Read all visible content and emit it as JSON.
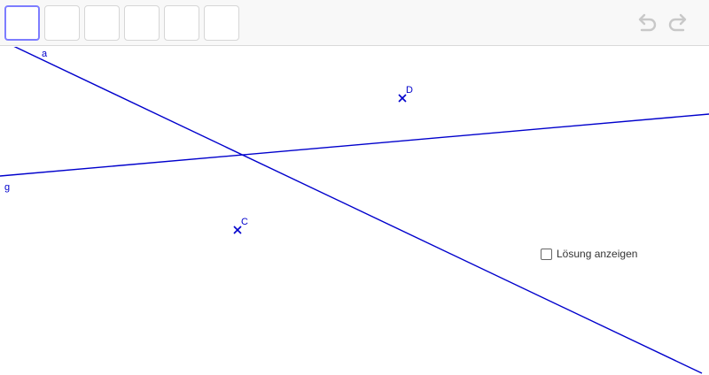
{
  "toolbar": {
    "tools": [
      "",
      "",
      "",
      "",
      "",
      ""
    ],
    "undo_icon": "undo-icon",
    "redo_icon": "redo-icon"
  },
  "construction": {
    "line_color": "#0000cc",
    "objects": {
      "line_a_label": "a",
      "line_g_label": "g",
      "point_c_label": "C",
      "point_d_label": "D"
    }
  },
  "solution": {
    "checkbox_label": "Lösung anzeigen",
    "checked": false
  }
}
